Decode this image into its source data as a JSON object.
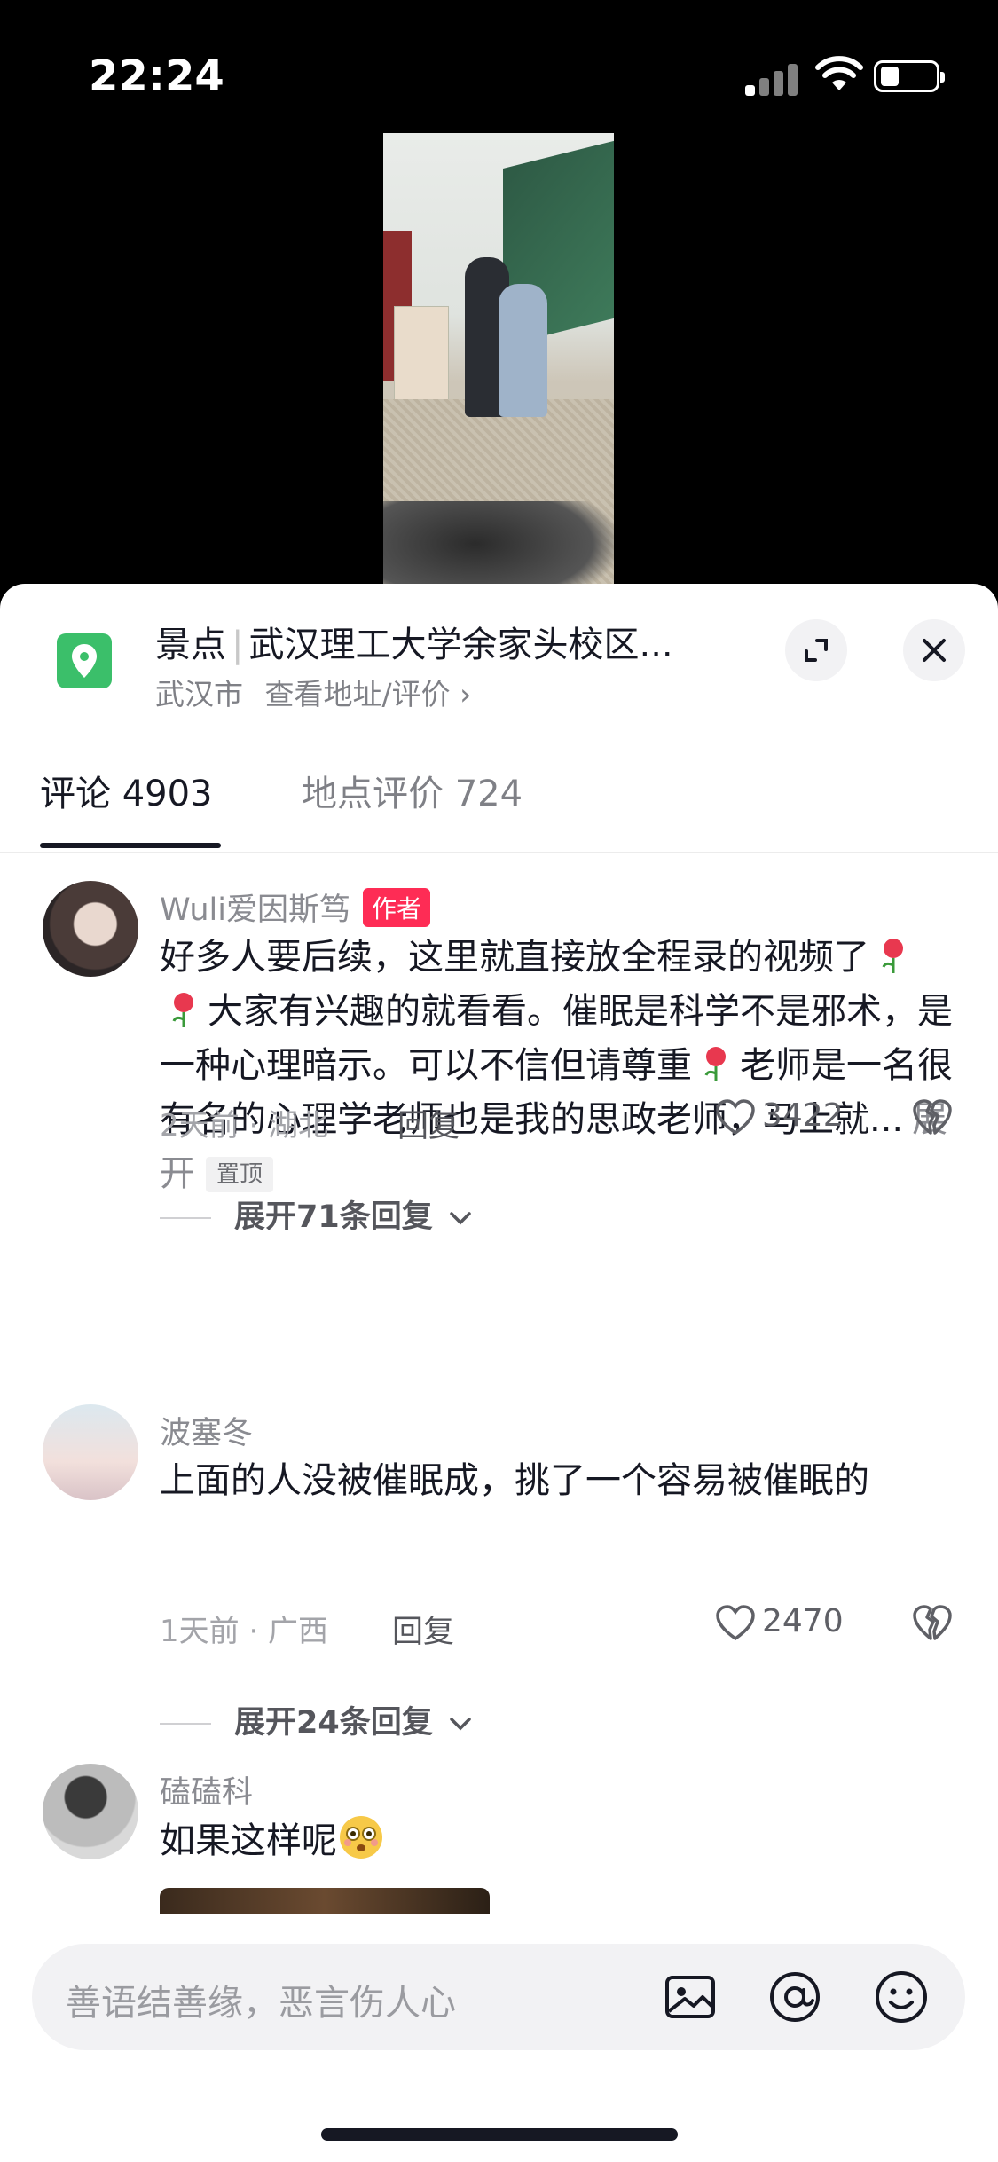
{
  "status_bar": {
    "time": "22:24"
  },
  "location": {
    "category": "景点",
    "name": "武汉理工大学余家头校区...",
    "city": "武汉市",
    "link": "查看地址/评价 ›"
  },
  "tabs": [
    {
      "label": "评论 4903",
      "active": true
    },
    {
      "label": "地点评价 724",
      "active": false
    }
  ],
  "comments": [
    {
      "user": "Wuli爱因斯笃",
      "badge": "作者",
      "text_parts": [
        "好多人要后续，这里就直接放全程录的视频了",
        "大家有兴趣的就看看。催眠是科学不是邪术，是一种心理暗示。可以不信但请尊重",
        "老师是一名很有名的心理学老师也是我的思政老师，马上就..."
      ],
      "more": "展开",
      "pinned": "置顶",
      "meta": "2天前 · 湖北",
      "reply": "回复",
      "likes": "3422",
      "expand_replies": "展开71条回复"
    },
    {
      "user": "波塞冬",
      "text": "上面的人没被催眠成，挑了一个容易被催眠的",
      "meta": "1天前 · 广西",
      "reply": "回复",
      "likes": "2470",
      "expand_replies": "展开24条回复"
    },
    {
      "user": "磕磕科",
      "text": "如果这样呢"
    }
  ],
  "input": {
    "placeholder": "善语结善缘，恶言伤人心"
  },
  "icons": {
    "location": "map-pin-icon",
    "expand": "expand-icon",
    "close": "close-icon",
    "like": "heart-icon",
    "dislike": "broken-heart-icon",
    "image": "image-icon",
    "mention": "at-icon",
    "emoji": "smile-icon"
  },
  "colors": {
    "accent": "#fe2c55",
    "location_icon": "#3bbf6a"
  }
}
